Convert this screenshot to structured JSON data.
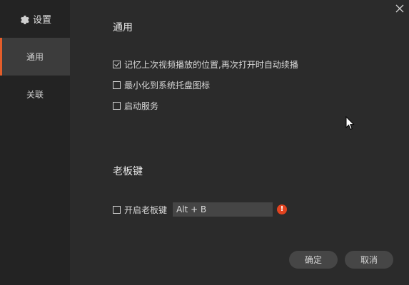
{
  "sidebar": {
    "header_label": "设置",
    "header_icon": "gear-icon",
    "items": [
      {
        "label": "通用",
        "active": true
      },
      {
        "label": "关联",
        "active": false
      }
    ]
  },
  "general": {
    "title": "通用",
    "options": [
      {
        "label": "记忆上次视频播放的位置,再次打开时自动续播",
        "checked": true
      },
      {
        "label": "最小化到系统托盘图标",
        "checked": false
      },
      {
        "label": "启动服务",
        "checked": false
      }
    ]
  },
  "boss_key": {
    "title": "老板键",
    "enable_label": "开启老板键",
    "enabled": false,
    "hotkey_value": "Alt + B"
  },
  "buttons": {
    "ok": "确定",
    "cancel": "取消"
  },
  "colors": {
    "accent": "#e35d2a",
    "warning": "#e2431f"
  }
}
